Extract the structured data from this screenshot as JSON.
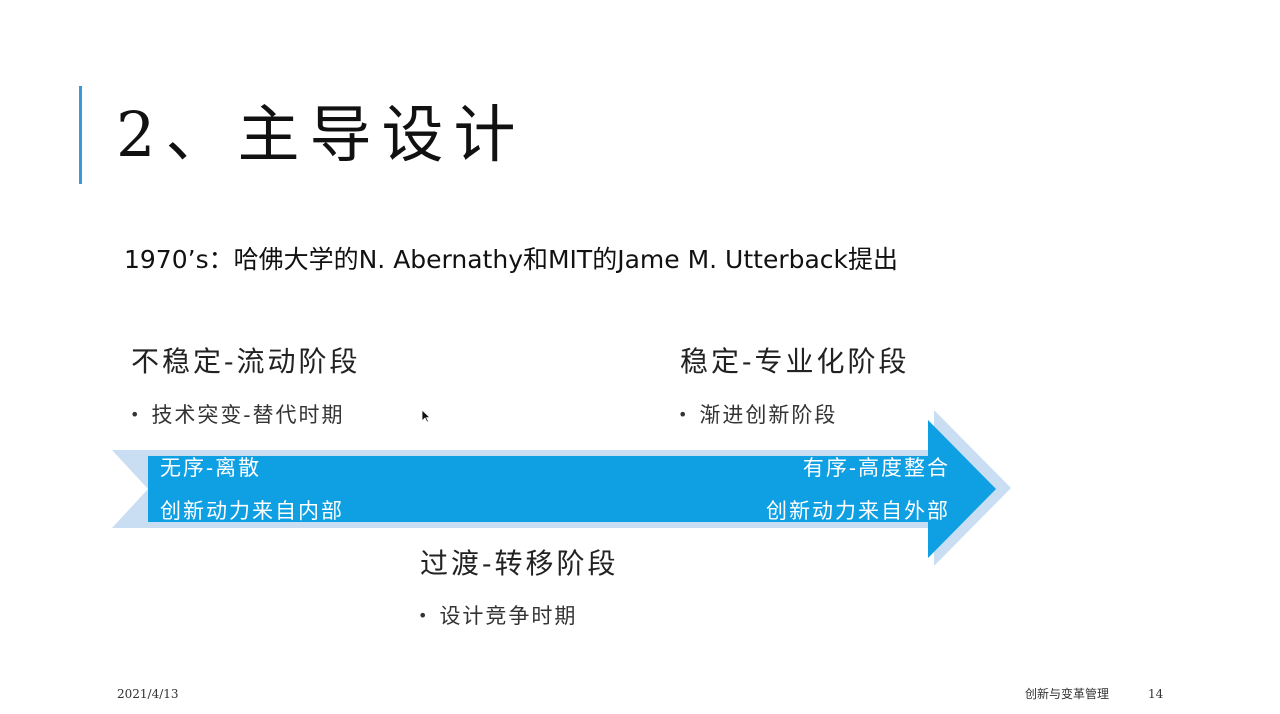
{
  "slide": {
    "title": "2、主导设计",
    "subtitle": "1970’s：哈佛大学的N. Abernathy和MIT的Jame M. Utterback提出"
  },
  "stages": {
    "unstable": {
      "heading": "不稳定-流动阶段",
      "bullet": "技术突变-替代时期"
    },
    "stable": {
      "heading": "稳定-专业化阶段",
      "bullet": "渐进创新阶段"
    },
    "transition": {
      "heading": "过渡-转移阶段",
      "bullet": "设计竞争时期"
    }
  },
  "arrow": {
    "left_top": "无序-离散",
    "left_bottom": "创新动力来自内部",
    "right_top": "有序-高度整合",
    "right_bottom": "创新动力来自外部",
    "fill_color": "#0f9fe3",
    "outer_color": "#c9def3"
  },
  "bullet_glyph": "•",
  "footer": {
    "date": "2021/4/13",
    "course": "创新与变革管理",
    "page_number": "14"
  },
  "colors": {
    "accent": "#3a9ad9",
    "text": "#111111"
  }
}
